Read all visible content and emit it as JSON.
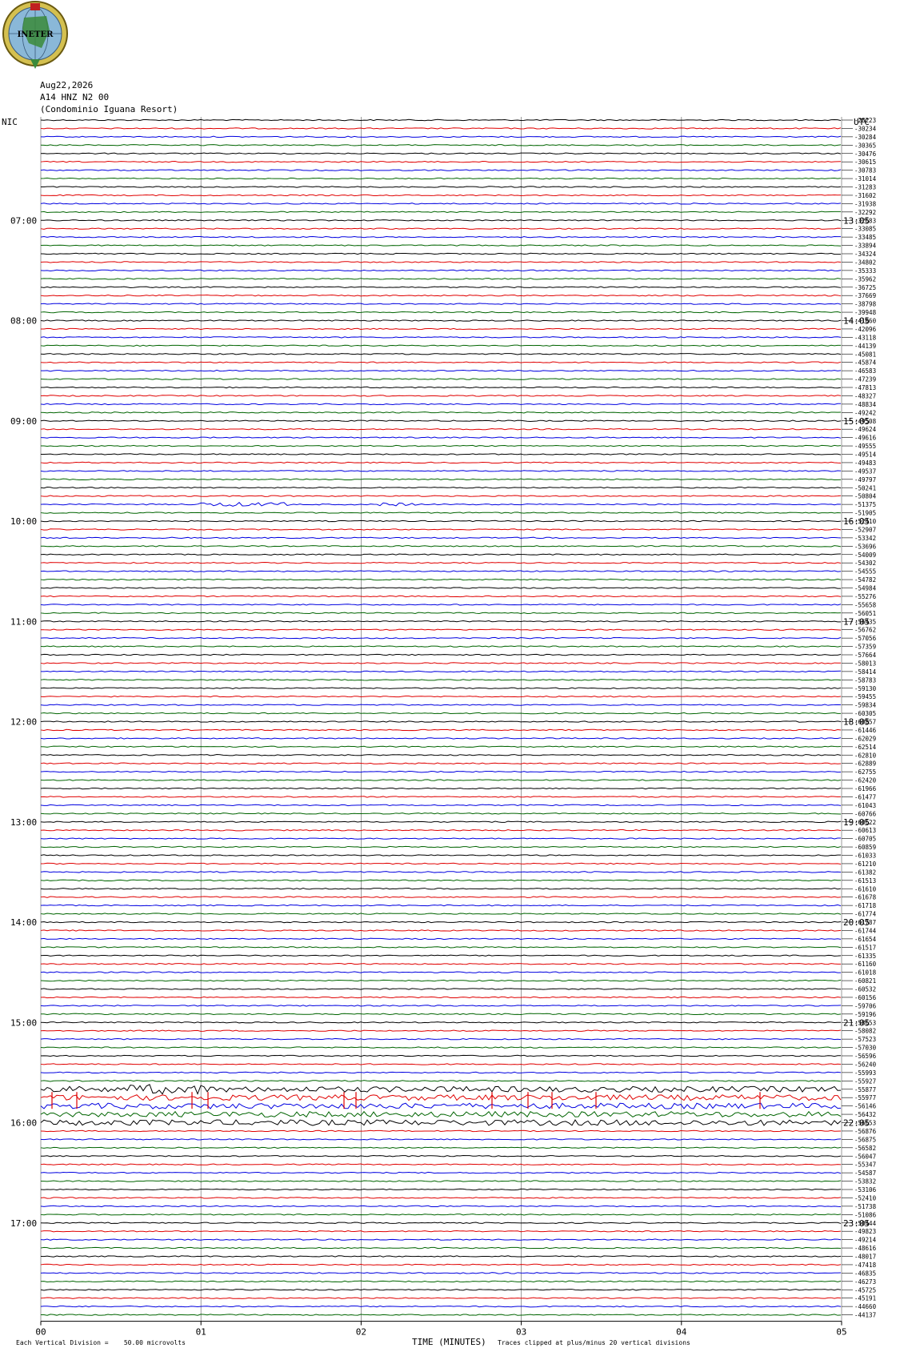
{
  "header": {
    "logo_text": "INETER",
    "date": "Aug22,2026",
    "channel": "A14 HNZ N2 00",
    "site": "(Condominio Iguana Resort)",
    "left_tz": "NIC",
    "right_tz": "UTC"
  },
  "footer": {
    "scale_note": "Each Vertical Division =    50.00 microvolts",
    "xlabel": "TIME (MINUTES)",
    "clip_note": "Traces clipped at plus/minus 20 vertical divisions"
  },
  "colors": {
    "cycle": [
      "#000000",
      "#e00000",
      "#0000e0",
      "#006400"
    ],
    "grid": "#808080"
  },
  "chart_data": {
    "type": "line",
    "title": "",
    "xlabel": "TIME (MINUTES)",
    "ylabel": "",
    "xlim": [
      0,
      5
    ],
    "x_ticks": [
      "00",
      "01",
      "02",
      "03",
      "04",
      "05"
    ],
    "n_traces": 144,
    "trace_minutes": 5,
    "left_time_labels": [
      {
        "trace": 12,
        "label": "07:00"
      },
      {
        "trace": 24,
        "label": "08:00"
      },
      {
        "trace": 36,
        "label": "09:00"
      },
      {
        "trace": 48,
        "label": "10:00"
      },
      {
        "trace": 60,
        "label": "11:00"
      },
      {
        "trace": 72,
        "label": "12:00"
      },
      {
        "trace": 84,
        "label": "13:00"
      },
      {
        "trace": 96,
        "label": "14:00"
      },
      {
        "trace": 108,
        "label": "15:00"
      },
      {
        "trace": 120,
        "label": "16:00"
      },
      {
        "trace": 132,
        "label": "17:00"
      }
    ],
    "right_time_labels": [
      {
        "trace": 12,
        "label": "13:05"
      },
      {
        "trace": 24,
        "label": "14:05"
      },
      {
        "trace": 36,
        "label": "15:05"
      },
      {
        "trace": 48,
        "label": "16:05"
      },
      {
        "trace": 60,
        "label": "17:05"
      },
      {
        "trace": 72,
        "label": "18:05"
      },
      {
        "trace": 84,
        "label": "19:05"
      },
      {
        "trace": 96,
        "label": "20:05"
      },
      {
        "trace": 108,
        "label": "21:05"
      },
      {
        "trace": 120,
        "label": "22:05"
      },
      {
        "trace": 132,
        "label": "23:05"
      }
    ],
    "trace_offsets": [
      -28223,
      -30234,
      -30284,
      -30365,
      -30476,
      -30615,
      -30783,
      -31014,
      -31283,
      -31602,
      -31938,
      -32292,
      -32683,
      -33085,
      -33485,
      -33894,
      -34324,
      -34802,
      -35333,
      -35962,
      -36725,
      -37669,
      -38798,
      -39948,
      -41060,
      -42096,
      -43118,
      -44139,
      -45081,
      -45874,
      -46583,
      -47239,
      -47813,
      -48327,
      -48834,
      -49242,
      -49508,
      -49624,
      -49616,
      -49555,
      -49514,
      -49483,
      -49537,
      -49797,
      -50241,
      -50804,
      -51375,
      -51905,
      -52410,
      -52907,
      -53342,
      -53696,
      -54009,
      -54302,
      -54555,
      -54782,
      -54984,
      -55276,
      -55658,
      -56051,
      -56435,
      -56762,
      -57056,
      -57359,
      -57664,
      -58013,
      -58414,
      -58783,
      -59130,
      -59455,
      -59834,
      -60305,
      -60857,
      -61446,
      -62029,
      -62514,
      -62810,
      -62889,
      -62755,
      -62420,
      -61966,
      -61477,
      -61043,
      -60766,
      -60622,
      -60613,
      -60705,
      -60859,
      -61033,
      -61210,
      -61382,
      -61513,
      -61610,
      -61678,
      -61718,
      -61774,
      -61787,
      -61744,
      -61654,
      -61517,
      -61335,
      -61160,
      -61018,
      -60821,
      -60532,
      -60156,
      -59706,
      -59196,
      -58653,
      -58082,
      -57523,
      -57030,
      -56596,
      -56240,
      -55993,
      -55927,
      -55877,
      -55977,
      -56146,
      -56432,
      -56653,
      -56876,
      -56875,
      -56582,
      -56047,
      -55347,
      -54587,
      -53832,
      -53106,
      -52410,
      -51738,
      -51086,
      -50444,
      -49823,
      -49214,
      -48616,
      -48017,
      -47418,
      -46835,
      -46273,
      -45725,
      -45191,
      -44660,
      -44137
    ]
  }
}
